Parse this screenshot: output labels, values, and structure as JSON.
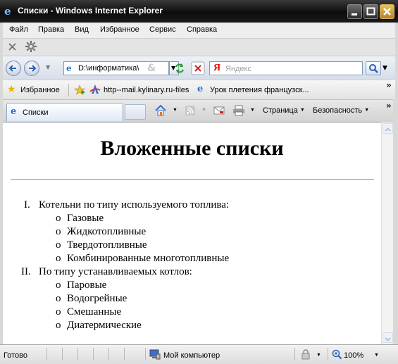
{
  "window": {
    "title": "Списки - Windows Internet Explorer"
  },
  "menu": [
    "Файл",
    "Правка",
    "Вид",
    "Избранное",
    "Сервис",
    "Справка"
  ],
  "address": {
    "value": "D:\\информатика\\"
  },
  "search": {
    "placeholder": "Яндекс",
    "logo": "Я"
  },
  "favorites": {
    "label": "Избранное",
    "links": [
      "http--mail.kylinary.ru-files",
      "Урок плетения французск..."
    ]
  },
  "tabs": [
    {
      "label": "Списки"
    }
  ],
  "toolbar": {
    "page": "Страница",
    "safety": "Безопасность"
  },
  "page": {
    "heading": "Вложенные списки",
    "list": [
      {
        "marker": "I.",
        "text": "Котельни по типу используемого топлива:",
        "items": [
          "Газовые",
          "Жидкотопливные",
          "Твердотопливные",
          "Комбинированные многотопливные"
        ]
      },
      {
        "marker": "II.",
        "text": "По типу устанавливаемых котлов:",
        "items": [
          "Паровые",
          "Водогрейные",
          "Смешанные",
          "Диатермические"
        ]
      }
    ],
    "bullet": "o"
  },
  "status": {
    "text": "Готово",
    "zone": "Мой компьютер",
    "zoom": "100%"
  }
}
